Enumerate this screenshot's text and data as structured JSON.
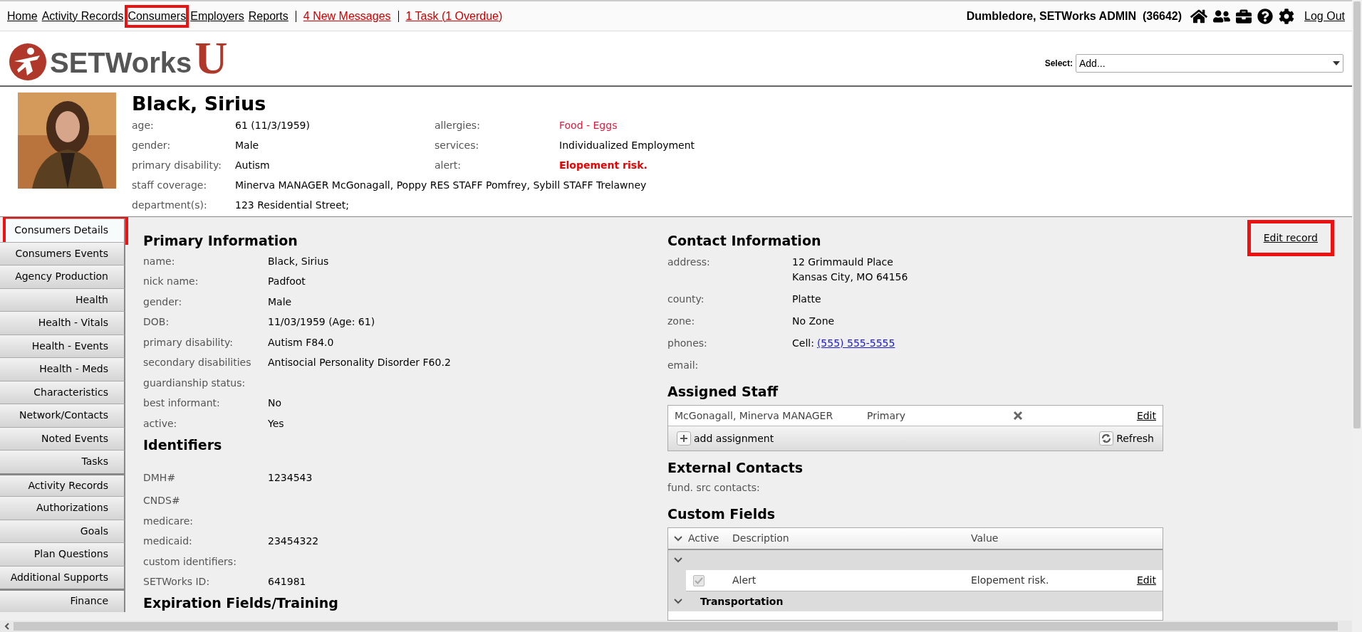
{
  "top_nav": {
    "links": [
      {
        "label": "Home",
        "highlighted": false
      },
      {
        "label": "Activity Records",
        "highlighted": false
      },
      {
        "label": "Consumers",
        "highlighted": true
      },
      {
        "label": "Employers",
        "highlighted": false
      },
      {
        "label": "Reports",
        "highlighted": false
      }
    ],
    "alerts": [
      {
        "label": "4 New Messages"
      },
      {
        "label": "1 Task (1 Overdue)"
      }
    ],
    "user": "Dumbledore, SETWorks ADMIN  (36642)",
    "logout": "Log Out"
  },
  "logo": {
    "text": "SETWorks",
    "letter": "U"
  },
  "select": {
    "label": "Select:",
    "value": "Add..."
  },
  "consumer": {
    "name": "Black, Sirius",
    "left_fields": [
      {
        "label": "age:",
        "value": "61 (11/3/1959)"
      },
      {
        "label": "gender:",
        "value": "Male"
      },
      {
        "label": "primary disability:",
        "value": "Autism"
      },
      {
        "label": "staff coverage:",
        "value": "Minerva MANAGER McGonagall, Poppy RES STAFF Pomfrey, Sybill STAFF Trelawney"
      },
      {
        "label": "department(s):",
        "value": "123 Residential Street;"
      }
    ],
    "right_fields": [
      {
        "label": "allergies:",
        "value": "Food - Eggs",
        "kind": "allergy"
      },
      {
        "label": "services:",
        "value": "Individualized Employment",
        "kind": "plain"
      },
      {
        "label": "alert:",
        "value": "Elopement risk.",
        "kind": "alert"
      }
    ]
  },
  "sidebar": [
    {
      "label": "Consumers Details",
      "selected": true,
      "highlighted": true,
      "group_start": false
    },
    {
      "label": "Consumers Events",
      "selected": false,
      "highlighted": false,
      "group_start": false
    },
    {
      "label": "Agency Production",
      "selected": false,
      "highlighted": false,
      "group_start": false
    },
    {
      "label": "Health",
      "selected": false,
      "highlighted": false,
      "group_start": false
    },
    {
      "label": "Health - Vitals",
      "selected": false,
      "highlighted": false,
      "group_start": false
    },
    {
      "label": "Health - Events",
      "selected": false,
      "highlighted": false,
      "group_start": false
    },
    {
      "label": "Health - Meds",
      "selected": false,
      "highlighted": false,
      "group_start": false
    },
    {
      "label": "Characteristics",
      "selected": false,
      "highlighted": false,
      "group_start": false
    },
    {
      "label": "Network/Contacts",
      "selected": false,
      "highlighted": false,
      "group_start": false
    },
    {
      "label": "Noted Events",
      "selected": false,
      "highlighted": false,
      "group_start": false
    },
    {
      "label": "Tasks",
      "selected": false,
      "highlighted": false,
      "group_start": false
    },
    {
      "label": "Activity Records",
      "selected": false,
      "highlighted": false,
      "group_start": true
    },
    {
      "label": "Authorizations",
      "selected": false,
      "highlighted": false,
      "group_start": false
    },
    {
      "label": "Goals",
      "selected": false,
      "highlighted": false,
      "group_start": false
    },
    {
      "label": "Plan Questions",
      "selected": false,
      "highlighted": false,
      "group_start": false
    },
    {
      "label": "Additional Supports",
      "selected": false,
      "highlighted": false,
      "group_start": false
    },
    {
      "label": "Finance",
      "selected": false,
      "highlighted": false,
      "group_start": true
    }
  ],
  "primary_information": {
    "title": "Primary Information",
    "rows": [
      {
        "label": "name:",
        "value": "Black, Sirius"
      },
      {
        "label": "nick name:",
        "value": "Padfoot"
      },
      {
        "label": "gender:",
        "value": "Male"
      },
      {
        "label": "DOB:",
        "value": "11/03/1959 (Age: 61)"
      },
      {
        "label": "primary disability:",
        "value": "Autism F84.0"
      },
      {
        "label": "secondary disabilities",
        "value": "Antisocial Personality Disorder F60.2"
      },
      {
        "label": "guardianship status:"
      },
      {
        "label": "best informant:",
        "value": "No"
      },
      {
        "label": "active:",
        "value": "Yes"
      }
    ]
  },
  "identifiers": {
    "title": "Identifiers",
    "rows": [
      {
        "label": "DMH#",
        "value": "1234543"
      },
      {
        "label": "CNDS#"
      },
      {
        "label": "medicare:"
      },
      {
        "label": "medicaid:",
        "value": "23454322"
      },
      {
        "label": "custom identifiers:"
      },
      {
        "label": "SETWorks ID:",
        "value": "641981"
      }
    ]
  },
  "expiration": {
    "title": "Expiration Fields/Training"
  },
  "edit_record": {
    "label": "Edit record",
    "highlighted": true
  },
  "contact_information": {
    "title": "Contact Information",
    "rows": [
      {
        "label": "address:",
        "lines": [
          "12 Grimmauld Place",
          "Kansas City, MO 64156"
        ]
      },
      {
        "label": "county:",
        "lines": [
          "Platte"
        ]
      },
      {
        "label": "zone:",
        "lines": [
          "No Zone"
        ]
      },
      {
        "label": "phones:",
        "lines": [
          "Cell:"
        ],
        "link": "(555) 555-5555"
      },
      {
        "label": "email:"
      }
    ]
  },
  "assigned_staff": {
    "title": "Assigned Staff",
    "rows": [
      {
        "name": "McGonagall, Minerva MANAGER",
        "role": "Primary",
        "action": "Edit"
      }
    ],
    "add": "add assignment",
    "refresh": "Refresh"
  },
  "external_contacts": {
    "title": "External Contacts",
    "label": "fund. src contacts:"
  },
  "custom_fields": {
    "title": "Custom Fields",
    "columns": [
      "Active",
      "Description",
      "Value"
    ],
    "groups": [
      {
        "rows": [
          {
            "checked": true,
            "description": "Alert",
            "value": "Elopement risk.",
            "action": "Edit"
          }
        ]
      },
      {
        "title": "Transportation"
      }
    ]
  }
}
